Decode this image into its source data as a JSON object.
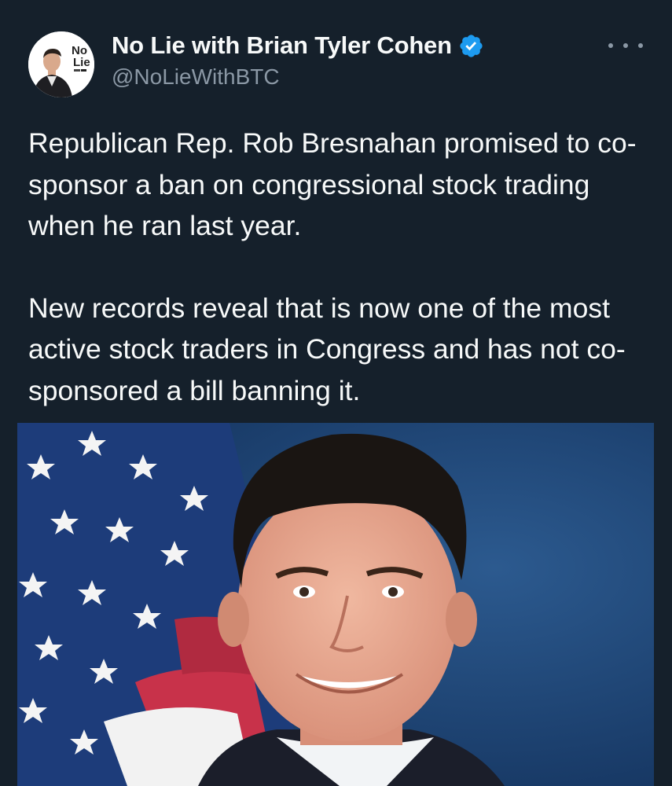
{
  "tweet": {
    "author": {
      "display_name": "No Lie with Brian Tyler Cohen",
      "handle": "@NoLieWithBTC",
      "verified": true,
      "avatar_logo_text": [
        "No",
        "Lie"
      ]
    },
    "more_icon": "ellipsis-icon",
    "verified_icon": "verified-badge-icon",
    "paragraphs": [
      "Republican Rep. Rob Bresnahan promised to co-sponsor a ban on congressional stock trading when he ran last year.",
      "New records reveal that is now one of the most active stock traders in Congress and has not co-sponsored a bill banning it."
    ],
    "media": {
      "kind": "photo"
    }
  },
  "colors": {
    "background": "#15202b",
    "primary_text": "#f7f9f9",
    "secondary_text": "#8b98a5",
    "verified_blue": "#1d9bf0"
  }
}
